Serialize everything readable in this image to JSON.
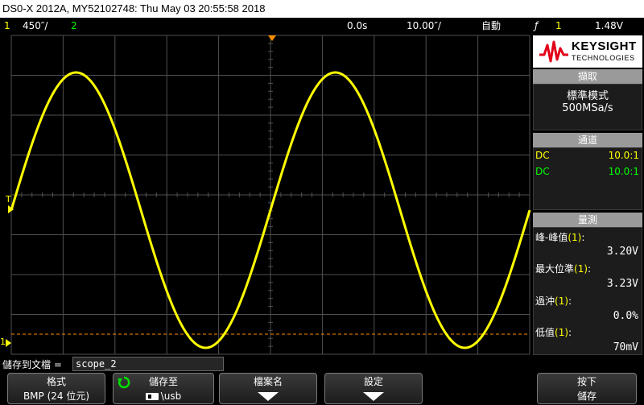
{
  "title": "DS0-X 2012A, MY52102748: Thu May 03 20:55:58 2018",
  "status": {
    "ch1_num": "1",
    "ch1_scale": "450″/",
    "ch2_num": "2",
    "time_offset": "0.0s",
    "time_scale": "10.00″/",
    "trigger_mode": "自動",
    "trigger_icon": "ƒ",
    "trigger_channel": "1",
    "trigger_level": "1.48V"
  },
  "brand": {
    "name": "KEYSIGHT",
    "sub": "TECHNOLOGIES",
    "color": "#e2001a"
  },
  "acquire": {
    "header": "擷取",
    "mode": "標準模式",
    "rate": "500MSa/s"
  },
  "channels": {
    "header": "通道",
    "rows": [
      {
        "coupling": "DC",
        "ratio": "10.0:1",
        "color": "#ffff00"
      },
      {
        "coupling": "DC",
        "ratio": "10.0:1",
        "color": "#00ff00"
      }
    ]
  },
  "measure": {
    "header": "量測",
    "items": [
      {
        "label": "峰-峰值",
        "ch": "(1)",
        "suffix": ":",
        "value": "3.20V"
      },
      {
        "label": "最大位準",
        "ch": "(1)",
        "suffix": ":",
        "value": "3.23V"
      },
      {
        "label": "過沖",
        "ch": "(1)",
        "suffix": ":",
        "value": "0.0%"
      },
      {
        "label": "低值",
        "ch": "(1)",
        "suffix": ":",
        "value": "70mV"
      }
    ]
  },
  "save": {
    "label": "儲存到文檔 =",
    "filename": "scope_2"
  },
  "softkeys": {
    "format_title": "格式",
    "format_value": "BMP (24 位元)",
    "saveto_title": "儲存至",
    "saveto_value": "\\usb",
    "filename_title": "檔案名",
    "settings_title": "設定",
    "press_title": "按下",
    "press_value": "儲存"
  },
  "markers": {
    "trigger_T": "T",
    "ch1_ground": "1"
  },
  "colors": {
    "ch1": "#ffff00",
    "ch2": "#00ff00",
    "trigger": "#ff8c00",
    "grid": "#505050"
  },
  "waveform": {
    "shape": "sine",
    "cycles": 2,
    "channel": "1"
  }
}
